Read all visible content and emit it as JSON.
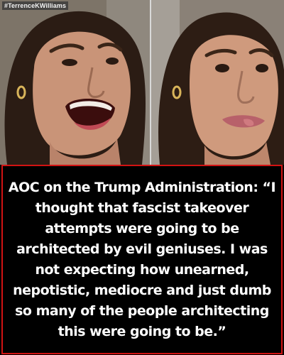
{
  "watermark": "#TerrenceKWilliams",
  "caption": {
    "text": "AOC on the Trump Administration: “I thought that fascist takeover attempts were going to be architected by evil geniuses. I was not expecting how unearned, nepotistic, mediocre and just dumb so many of the people architecting this were going to be.”"
  },
  "colors": {
    "caption_border": "#d21313",
    "caption_background": "#000000",
    "caption_text": "#ffffff"
  }
}
